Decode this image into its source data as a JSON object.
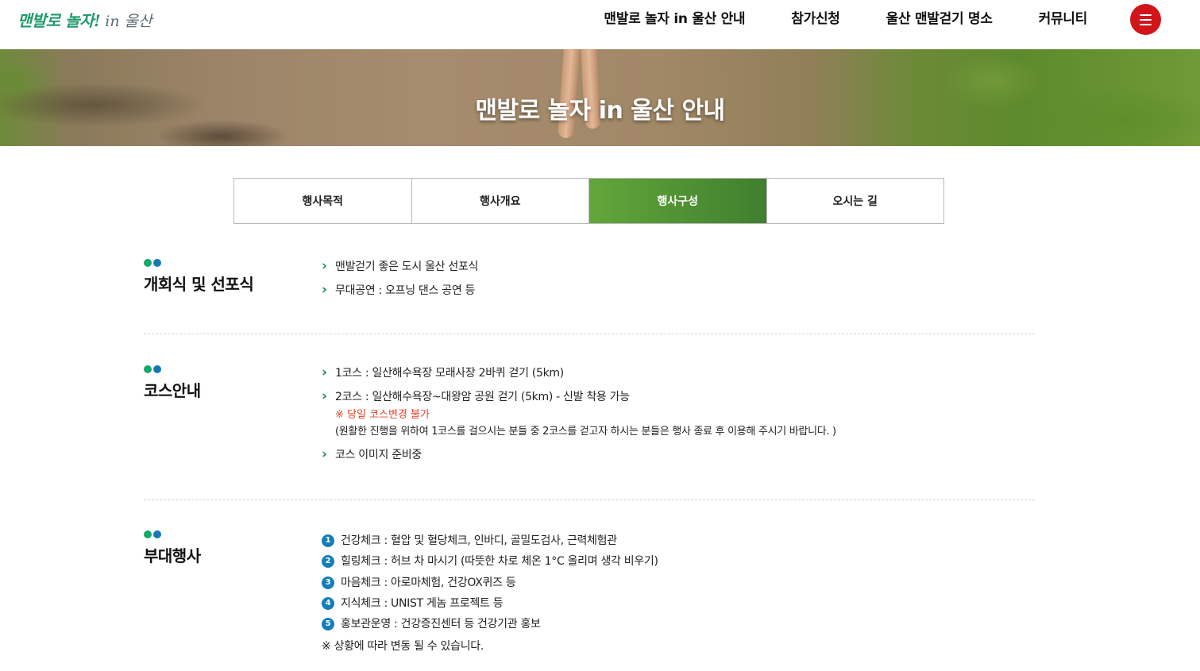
{
  "header": {
    "logo_main": "맨발로 놀자!",
    "logo_sub": "in 울산",
    "nav": [
      "맨발로 놀자 in 울산 안내",
      "참가신청",
      "울산 맨발걷기 명소",
      "커뮤니티"
    ]
  },
  "banner": {
    "title": "맨발로 놀자 in 울산 안내"
  },
  "tabs": [
    {
      "label": "행사목적"
    },
    {
      "label": "행사개요"
    },
    {
      "label": "행사구성",
      "active": true
    },
    {
      "label": "오시는 길"
    }
  ],
  "sections": {
    "opening": {
      "title": "개회식 및 선포식",
      "items": [
        "맨발걷기 좋은 도시 울산 선포식",
        "무대공연 : 오프닝 댄스 공연 등"
      ]
    },
    "course": {
      "title": "코스안내",
      "item1": "1코스 : 일산해수욕장 모래사장 2바퀴 걷기 (5km)",
      "item2": "2코스 : 일산해수욕장~대왕암 공원 걷기 (5km) - 신발 착용 가능",
      "warning": "※ 당일 코스변경 불가",
      "note": "(원활한 진행을 위하여 1코스를 걸으시는 분들 중 2코스를 걷고자 하시는 분들은 행사 종료 후 이용해 주시기 바랍니다. )",
      "item3": "코스 이미지 준비중"
    },
    "side": {
      "title": "부대행사",
      "items": [
        {
          "num": "1",
          "text": "건강체크 : 혈압 및 혈당체크, 인바디, 골밀도검사, 근력체험관"
        },
        {
          "num": "2",
          "text": "힐링체크 : 허브 차 마시기 (따뜻한 차로 체온 1°C 올리며 생각 비우기)"
        },
        {
          "num": "3",
          "text": "마음체크 : 아로마체험, 건강OX퀴즈 등"
        },
        {
          "num": "4",
          "text": "지식체크 : UNIST 게놈 프로젝트 등"
        },
        {
          "num": "5",
          "text": "홍보관운영 : 건강증진센터 등 건강기관 홍보"
        }
      ],
      "footnote": "※ 상황에 따라 변동 될 수 있습니다."
    }
  },
  "colors": {
    "accent_green": "#3f7f2e",
    "brand_red": "#d2151b",
    "badge_blue": "#157eb8",
    "warning_red": "#e0452b"
  }
}
